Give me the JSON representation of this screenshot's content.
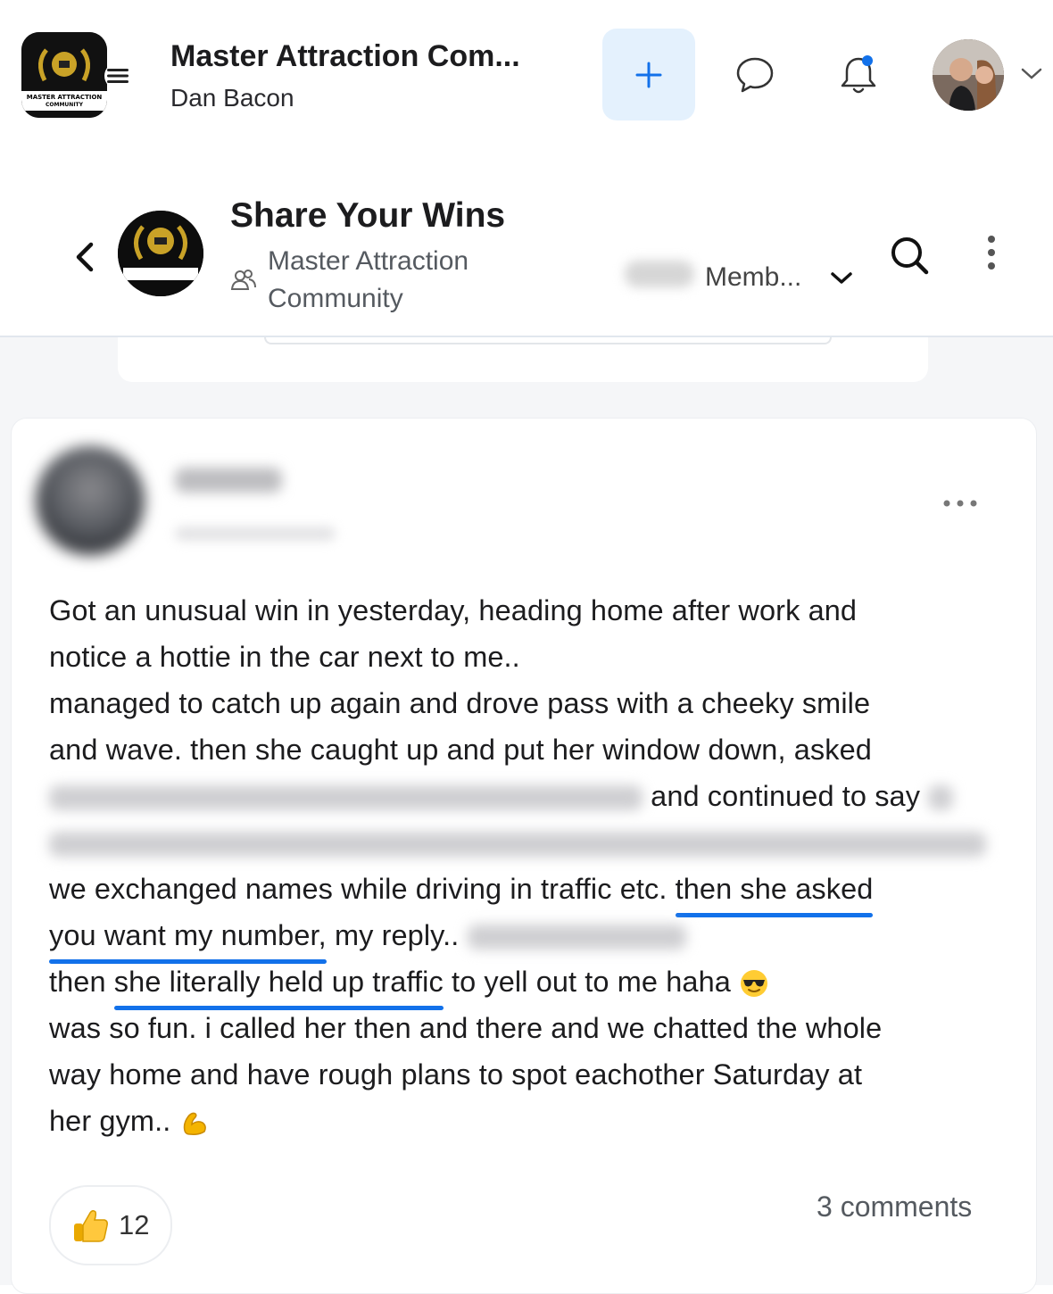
{
  "app": {
    "title": "Master Attraction Com...",
    "subtitle": "Dan Bacon",
    "logo_text_line1": "MASTER ATTRACTION",
    "logo_text_line2": "COMMUNITY",
    "accent_color": "#1271ea",
    "create_button_icon": "plus-icon",
    "has_notification_dot": true
  },
  "group": {
    "title": "Share Your Wins",
    "community": "Master Attraction Community",
    "members_label": "Memb..."
  },
  "post": {
    "author_name": "",
    "timestamp": "",
    "body": {
      "line1": "Got an unusual win in yesterday, heading home after work and",
      "line2": "notice a hottie in the car next to me..",
      "line3": "managed to catch up again and drove pass with a cheeky smile",
      "line4": "and wave. then she caught up and put her window down, asked",
      "line5_visible": "and continued to say",
      "line7_a": "we exchanged names while driving in traffic etc.",
      "line7_hl": "then she asked",
      "line8_hl": "you want my number,",
      "line8_b": "my reply..",
      "line9_a": "then",
      "line9_hl": "she literally held up traffic",
      "line9_b": "to yell out to me haha",
      "line10": "was so fun. i called her then and there and we chatted the whole",
      "line11": "way home and have rough plans to spot eachother Saturday at",
      "line12": "her gym.."
    },
    "emojis": [
      "sunglasses-emoji",
      "flexed-biceps-emoji"
    ],
    "likes": "12",
    "comments": "3 comments"
  }
}
